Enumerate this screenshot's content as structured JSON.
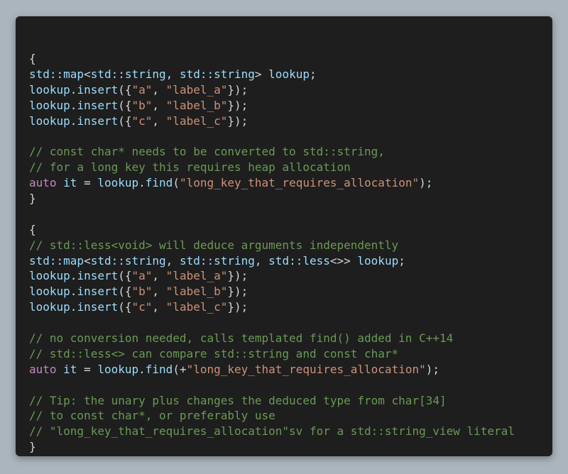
{
  "colors": {
    "background": "#aab5be",
    "editor_background": "#1e1e1e",
    "plain": "#d4d4d4",
    "identifier": "#9cdcfe",
    "string": "#ce9178",
    "comment": "#6a9955",
    "keyword": "#c586c0"
  },
  "code_lines": [
    [
      {
        "t": "punct",
        "s": "{"
      }
    ],
    [
      {
        "t": "type",
        "s": "std::map"
      },
      {
        "t": "punct",
        "s": "<"
      },
      {
        "t": "type",
        "s": "std::string"
      },
      {
        "t": "punct",
        "s": ", "
      },
      {
        "t": "type",
        "s": "std::string"
      },
      {
        "t": "punct",
        "s": "> "
      },
      {
        "t": "var",
        "s": "lookup"
      },
      {
        "t": "punct",
        "s": ";"
      }
    ],
    [
      {
        "t": "var",
        "s": "lookup"
      },
      {
        "t": "punct",
        "s": "."
      },
      {
        "t": "fn",
        "s": "insert"
      },
      {
        "t": "punct",
        "s": "({"
      },
      {
        "t": "str",
        "s": "\"a\""
      },
      {
        "t": "punct",
        "s": ", "
      },
      {
        "t": "str",
        "s": "\"label_a\""
      },
      {
        "t": "punct",
        "s": "});"
      }
    ],
    [
      {
        "t": "var",
        "s": "lookup"
      },
      {
        "t": "punct",
        "s": "."
      },
      {
        "t": "fn",
        "s": "insert"
      },
      {
        "t": "punct",
        "s": "({"
      },
      {
        "t": "str",
        "s": "\"b\""
      },
      {
        "t": "punct",
        "s": ", "
      },
      {
        "t": "str",
        "s": "\"label_b\""
      },
      {
        "t": "punct",
        "s": "});"
      }
    ],
    [
      {
        "t": "var",
        "s": "lookup"
      },
      {
        "t": "punct",
        "s": "."
      },
      {
        "t": "fn",
        "s": "insert"
      },
      {
        "t": "punct",
        "s": "({"
      },
      {
        "t": "str",
        "s": "\"c\""
      },
      {
        "t": "punct",
        "s": ", "
      },
      {
        "t": "str",
        "s": "\"label_c\""
      },
      {
        "t": "punct",
        "s": "});"
      }
    ],
    [],
    [
      {
        "t": "comment",
        "s": "// const char* needs to be converted to std::string,"
      }
    ],
    [
      {
        "t": "comment",
        "s": "// for a long key this requires heap allocation"
      }
    ],
    [
      {
        "t": "kw",
        "s": "auto"
      },
      {
        "t": "punct",
        "s": " "
      },
      {
        "t": "var",
        "s": "it"
      },
      {
        "t": "punct",
        "s": " = "
      },
      {
        "t": "var",
        "s": "lookup"
      },
      {
        "t": "punct",
        "s": "."
      },
      {
        "t": "fn",
        "s": "find"
      },
      {
        "t": "punct",
        "s": "("
      },
      {
        "t": "str",
        "s": "\"long_key_that_requires_allocation\""
      },
      {
        "t": "punct",
        "s": ");"
      }
    ],
    [
      {
        "t": "punct",
        "s": "}"
      }
    ],
    [],
    [
      {
        "t": "punct",
        "s": "{"
      }
    ],
    [
      {
        "t": "comment",
        "s": "// std::less<void> will deduce arguments independently"
      }
    ],
    [
      {
        "t": "type",
        "s": "std::map"
      },
      {
        "t": "punct",
        "s": "<"
      },
      {
        "t": "type",
        "s": "std::string"
      },
      {
        "t": "punct",
        "s": ", "
      },
      {
        "t": "type",
        "s": "std::string"
      },
      {
        "t": "punct",
        "s": ", "
      },
      {
        "t": "type",
        "s": "std::less"
      },
      {
        "t": "punct",
        "s": "<>> "
      },
      {
        "t": "var",
        "s": "lookup"
      },
      {
        "t": "punct",
        "s": ";"
      }
    ],
    [
      {
        "t": "var",
        "s": "lookup"
      },
      {
        "t": "punct",
        "s": "."
      },
      {
        "t": "fn",
        "s": "insert"
      },
      {
        "t": "punct",
        "s": "({"
      },
      {
        "t": "str",
        "s": "\"a\""
      },
      {
        "t": "punct",
        "s": ", "
      },
      {
        "t": "str",
        "s": "\"label_a\""
      },
      {
        "t": "punct",
        "s": "});"
      }
    ],
    [
      {
        "t": "var",
        "s": "lookup"
      },
      {
        "t": "punct",
        "s": "."
      },
      {
        "t": "fn",
        "s": "insert"
      },
      {
        "t": "punct",
        "s": "({"
      },
      {
        "t": "str",
        "s": "\"b\""
      },
      {
        "t": "punct",
        "s": ", "
      },
      {
        "t": "str",
        "s": "\"label_b\""
      },
      {
        "t": "punct",
        "s": "});"
      }
    ],
    [
      {
        "t": "var",
        "s": "lookup"
      },
      {
        "t": "punct",
        "s": "."
      },
      {
        "t": "fn",
        "s": "insert"
      },
      {
        "t": "punct",
        "s": "({"
      },
      {
        "t": "str",
        "s": "\"c\""
      },
      {
        "t": "punct",
        "s": ", "
      },
      {
        "t": "str",
        "s": "\"label_c\""
      },
      {
        "t": "punct",
        "s": "});"
      }
    ],
    [],
    [
      {
        "t": "comment",
        "s": "// no conversion needed, calls templated find() added in C++14"
      }
    ],
    [
      {
        "t": "comment",
        "s": "// std::less<> can compare std::string and const char*"
      }
    ],
    [
      {
        "t": "kw",
        "s": "auto"
      },
      {
        "t": "punct",
        "s": " "
      },
      {
        "t": "var",
        "s": "it"
      },
      {
        "t": "punct",
        "s": " = "
      },
      {
        "t": "var",
        "s": "lookup"
      },
      {
        "t": "punct",
        "s": "."
      },
      {
        "t": "fn",
        "s": "find"
      },
      {
        "t": "punct",
        "s": "(+"
      },
      {
        "t": "str",
        "s": "\"long_key_that_requires_allocation\""
      },
      {
        "t": "punct",
        "s": ");"
      }
    ],
    [],
    [
      {
        "t": "comment",
        "s": "// Tip: the unary plus changes the deduced type from char[34]"
      }
    ],
    [
      {
        "t": "comment",
        "s": "// to const char*, or preferably use"
      }
    ],
    [
      {
        "t": "comment",
        "s": "// \"long_key_that_requires_allocation\"sv for a std::string_view literal"
      }
    ],
    [
      {
        "t": "punct",
        "s": "}"
      }
    ]
  ]
}
